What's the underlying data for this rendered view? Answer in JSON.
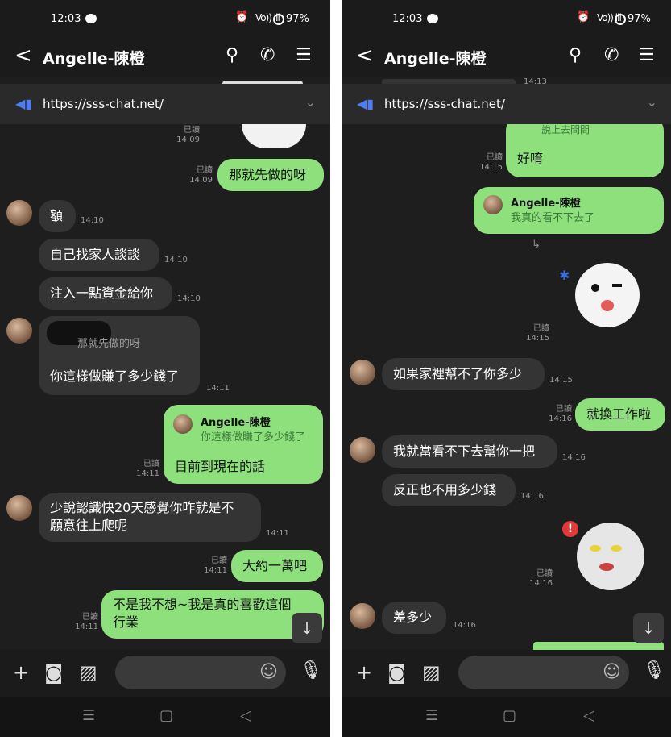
{
  "status": {
    "time": "12:03",
    "battery": "97%",
    "signal": "Vo)) ill"
  },
  "header": {
    "title": "Angelle-陳橙",
    "back": "<",
    "search": "⚲",
    "call": "✆",
    "menu": "☰"
  },
  "announcement": {
    "url": "https://sss-chat.net/"
  },
  "read_label": "已讀",
  "left": {
    "messages": [
      {
        "time": "14:09"
      },
      {
        "text": "那就先做的呀",
        "time": "14:09"
      },
      {
        "text": "額",
        "time": "14:10"
      },
      {
        "text": "自己找家人談談",
        "time": "14:10"
      },
      {
        "text": "注入一點資金給你",
        "time": "14:10"
      },
      {
        "reply_quote": "那就先做的呀",
        "text": "你這樣做賺了多少錢了",
        "time": "14:11"
      },
      {
        "reply_name": "Angelle-陳橙",
        "reply_quote": "你這樣做賺了多少錢了",
        "text": "目前到現在的話",
        "time": "14:11"
      },
      {
        "text_line1": "少說認識快20天感覺你咋就是不",
        "text_line2": "願意往上爬呢",
        "time": "14:11"
      },
      {
        "text": "大約一萬吧",
        "time": "14:11"
      },
      {
        "text_line1": "不是我不想~我是真的喜歡這個",
        "text_line2": "行業",
        "time": "14:11"
      }
    ]
  },
  "right": {
    "messages": [
      {
        "time": "14:13"
      },
      {
        "partial": "說上去問問",
        "text": "好唷",
        "time": "14:15"
      },
      {
        "reply_name": "Angelle-陳橙",
        "reply_text": "我真的看不下去了"
      },
      {
        "time": "14:15"
      },
      {
        "text": "如果家裡幫不了你多少",
        "time": "14:15"
      },
      {
        "text": "就換工作啦",
        "time": "14:16"
      },
      {
        "text": "我就當看不下去幫你一把",
        "time": "14:16"
      },
      {
        "text": "反正也不用多少錢",
        "time": "14:16"
      },
      {
        "time": "14:16"
      },
      {
        "text": "差多少",
        "time": "14:16"
      }
    ]
  },
  "footer": {
    "plus": "+",
    "camera": "◙",
    "gallery": "▨",
    "emoji": "☺",
    "mic": "🎙"
  },
  "navbar": {
    "recent": "☰",
    "home": "▢",
    "back": "◁"
  },
  "scroll_down": "↓",
  "colors": {
    "out_bubble": "#8de07c",
    "in_bubble": "#343434",
    "background": "#1e1e1e",
    "announce_icon": "#4f7df0"
  }
}
